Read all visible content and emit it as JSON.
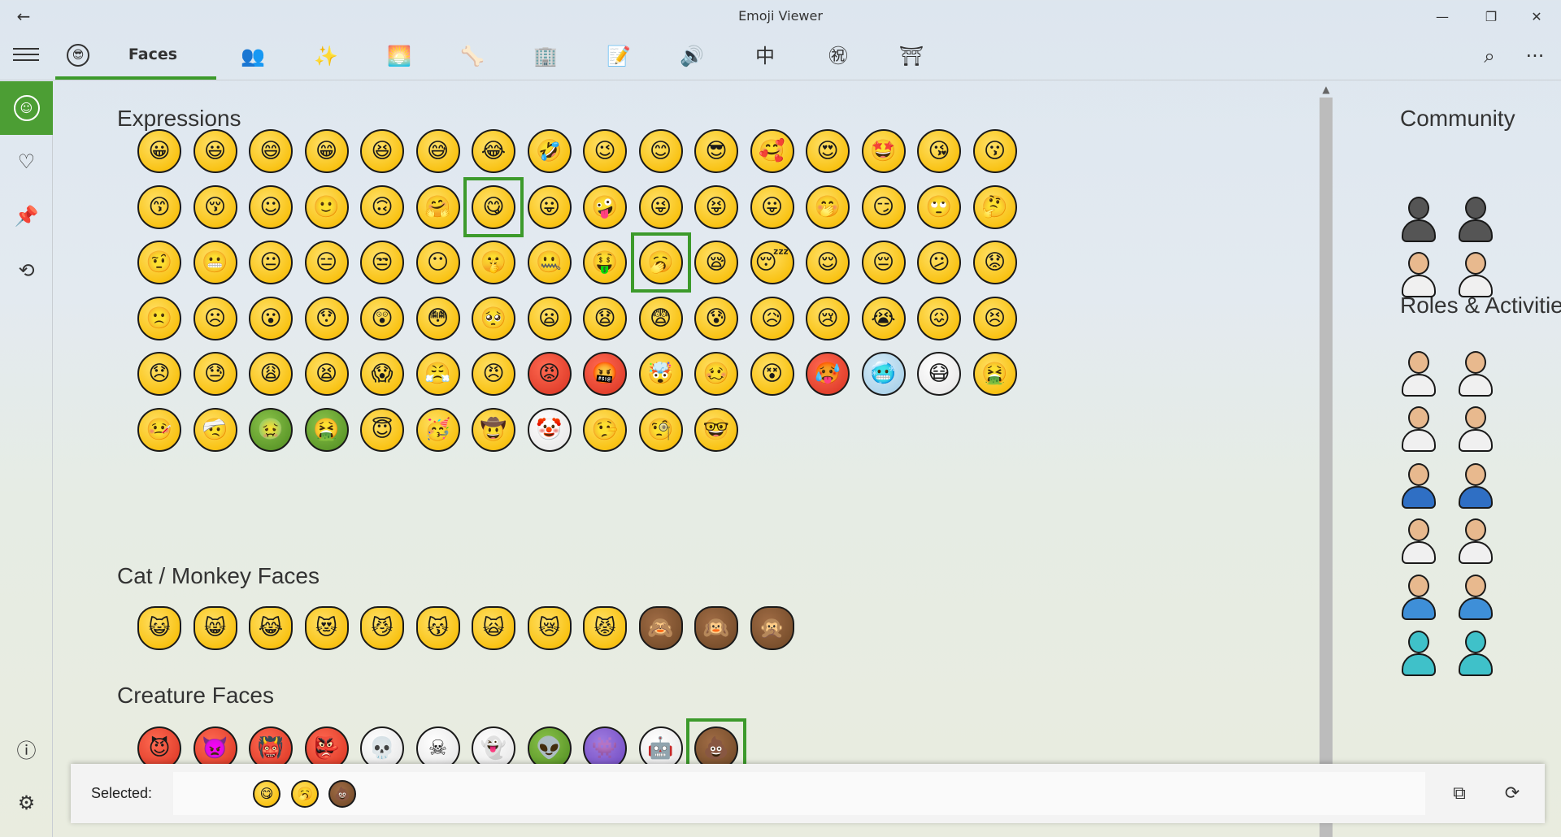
{
  "app": {
    "title": "Emoji Viewer"
  },
  "titlebar": {
    "back_icon": "←",
    "minimize_icon": "—",
    "maximize_icon": "❐",
    "close_icon": "✕"
  },
  "tabs": {
    "active_label": "Faces",
    "category_icons": [
      "👥",
      "✨",
      "🌅",
      "🦴",
      "🏢",
      "📝",
      "🔊",
      "中",
      "㊗",
      "⛩"
    ]
  },
  "toolbar": {
    "search_icon": "⌕",
    "more_icon": "···"
  },
  "rail": {
    "faces_icon": "☺",
    "symbols_icon": "♡",
    "pin_icon": "📌",
    "history_icon": "⟲",
    "info_icon": "ⓘ",
    "settings_icon": "⚙"
  },
  "sections": {
    "expressions_title": "Expressions",
    "cat_monkey_title": "Cat / Monkey Faces",
    "creature_title": "Creature Faces"
  },
  "right_panel": {
    "community_title": "Community",
    "roles_title": "Roles & Activities"
  },
  "selected_bar": {
    "label": "Selected:",
    "copy_icon": "⧉",
    "clear_icon": "⟳"
  },
  "colors": {
    "accent": "#3c9a2b",
    "rail_active": "#4c9e34"
  }
}
